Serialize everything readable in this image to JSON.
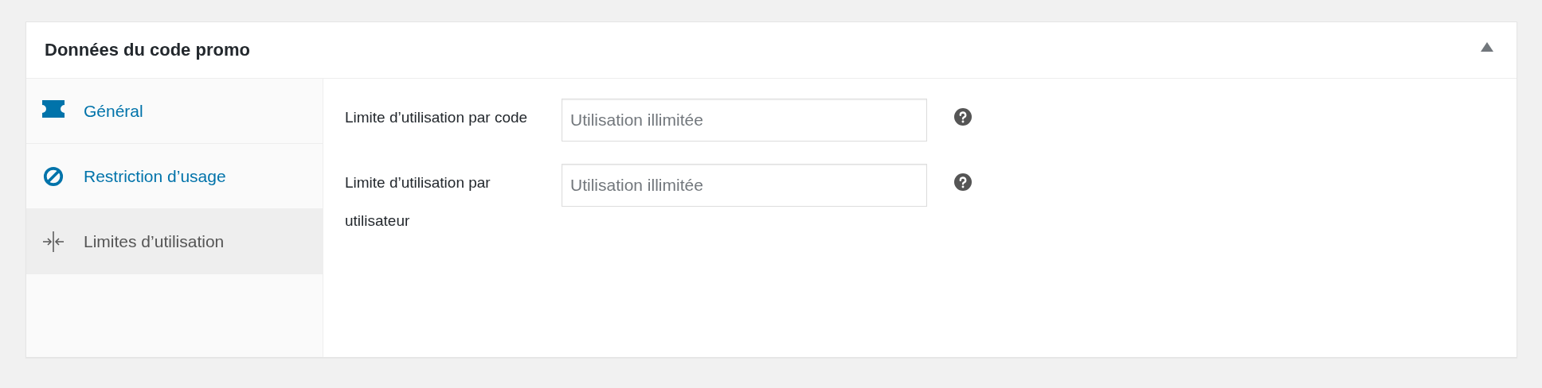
{
  "panel": {
    "title": "Données du code promo",
    "expanded": true
  },
  "tabs": [
    {
      "label": "Général",
      "selected": false
    },
    {
      "label": "Restriction d’usage",
      "selected": false
    },
    {
      "label": "Limites d’utilisation",
      "selected": true
    }
  ],
  "fields": [
    {
      "label": "Limite d’utilisation par code",
      "placeholder": "Utilisation illimitée"
    },
    {
      "label": "Limite d’utilisation par utilisateur",
      "placeholder": "Utilisation illimitée"
    }
  ]
}
